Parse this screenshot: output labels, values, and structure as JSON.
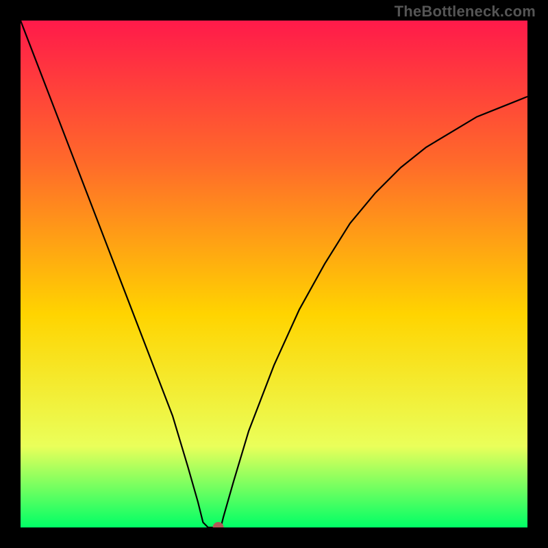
{
  "watermark": "TheBottleneck.com",
  "chart_data": {
    "type": "line",
    "title": "",
    "xlabel": "",
    "ylabel": "",
    "xlim": [
      0,
      1
    ],
    "ylim": [
      0,
      1
    ],
    "background_gradient": {
      "top": "#ff1a4a",
      "mid_upper": "#ff6a2a",
      "mid": "#ffd400",
      "lower": "#eaff5a",
      "bottom": "#00ff66"
    },
    "minimum": {
      "x": 0.38,
      "y": 0.0
    },
    "marker": {
      "x": 0.39,
      "y": 0.0,
      "color": "#b15a58",
      "radius_px": 8
    },
    "series": [
      {
        "name": "curve",
        "color": "#000000",
        "points": [
          {
            "x": 0.0,
            "y": 1.0
          },
          {
            "x": 0.05,
            "y": 0.87
          },
          {
            "x": 0.1,
            "y": 0.74
          },
          {
            "x": 0.15,
            "y": 0.61
          },
          {
            "x": 0.2,
            "y": 0.48
          },
          {
            "x": 0.25,
            "y": 0.35
          },
          {
            "x": 0.3,
            "y": 0.22
          },
          {
            "x": 0.33,
            "y": 0.12
          },
          {
            "x": 0.35,
            "y": 0.05
          },
          {
            "x": 0.36,
            "y": 0.01
          },
          {
            "x": 0.37,
            "y": 0.0
          },
          {
            "x": 0.38,
            "y": 0.0
          },
          {
            "x": 0.395,
            "y": 0.0
          },
          {
            "x": 0.4,
            "y": 0.02
          },
          {
            "x": 0.42,
            "y": 0.09
          },
          {
            "x": 0.45,
            "y": 0.19
          },
          {
            "x": 0.5,
            "y": 0.32
          },
          {
            "x": 0.55,
            "y": 0.43
          },
          {
            "x": 0.6,
            "y": 0.52
          },
          {
            "x": 0.65,
            "y": 0.6
          },
          {
            "x": 0.7,
            "y": 0.66
          },
          {
            "x": 0.75,
            "y": 0.71
          },
          {
            "x": 0.8,
            "y": 0.75
          },
          {
            "x": 0.85,
            "y": 0.78
          },
          {
            "x": 0.9,
            "y": 0.81
          },
          {
            "x": 0.95,
            "y": 0.83
          },
          {
            "x": 1.0,
            "y": 0.85
          }
        ]
      }
    ]
  }
}
